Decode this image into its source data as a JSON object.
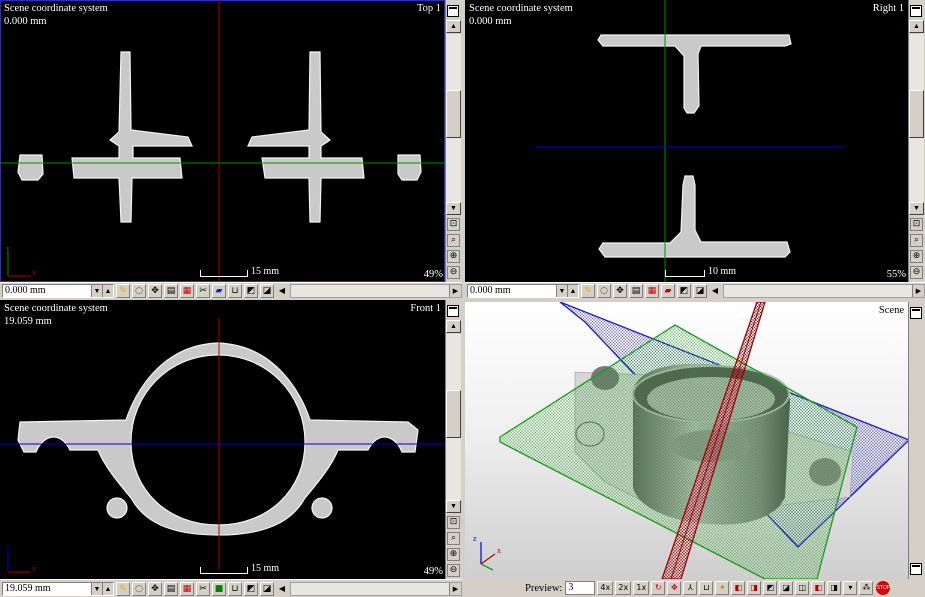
{
  "views": {
    "top": {
      "title": "Top 1",
      "coord_system": "Scene coordinate system",
      "position": "0.000 mm",
      "scale_label": "15 mm",
      "zoom": "49%",
      "slice_value": "0.000 mm"
    },
    "right": {
      "title": "Right 1",
      "coord_system": "Scene coordinate system",
      "position": "0.000 mm",
      "scale_label": "10 mm",
      "zoom": "55%",
      "slice_value": "0.000 mm"
    },
    "front": {
      "title": "Front 1",
      "coord_system": "Scene coordinate system",
      "position": "19.059 mm",
      "scale_label": "15 mm",
      "zoom": "49%",
      "slice_value": "19.059 mm"
    },
    "scene": {
      "title": "Scene",
      "preview_label": "Preview:",
      "preview_value": "3",
      "zoom_buttons": [
        "4x",
        "2x",
        "1x"
      ]
    }
  },
  "axes": {
    "x": "x",
    "y": "y",
    "z": "z"
  },
  "stop_label": "STOP",
  "colors": {
    "crosshair_red": "#b00000",
    "crosshair_green": "#009000",
    "crosshair_blue": "#0000d0",
    "active_border": "#2b2bd6",
    "part_gray": "#c8c8c8"
  }
}
